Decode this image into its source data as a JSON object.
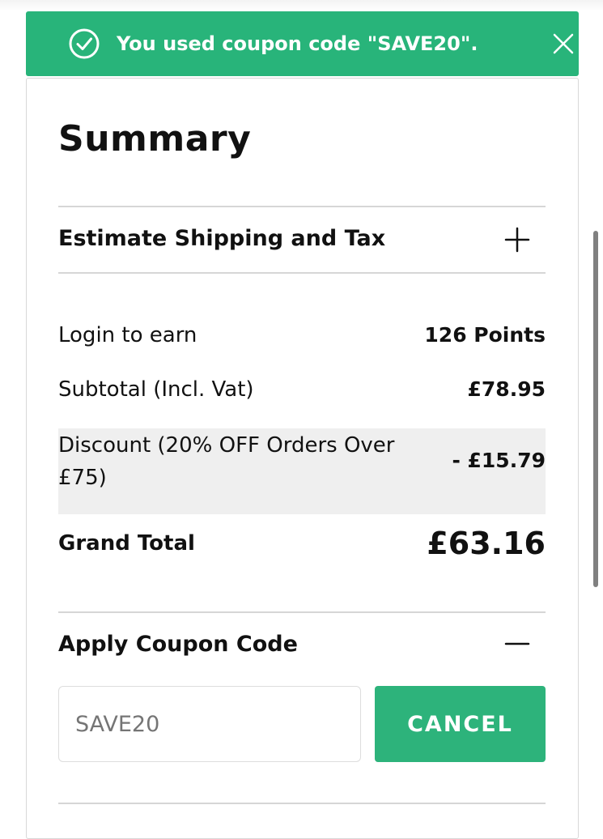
{
  "banner": {
    "message": "You used coupon code \"SAVE20\".",
    "color": "#28b47a"
  },
  "summary": {
    "title": "Summary"
  },
  "shipping": {
    "title": "Estimate Shipping and Tax"
  },
  "totals": {
    "login_label": "Login to earn",
    "login_value": "126 Points",
    "subtotal_label": "Subtotal (Incl. Vat)",
    "subtotal_value": "£78.95",
    "discount_label": "Discount (20% OFF Orders Over £75)",
    "discount_value": "- £15.79",
    "grand_label": "Grand Total",
    "grand_value": "£63.16"
  },
  "coupon": {
    "title": "Apply Coupon Code",
    "input_placeholder": "SAVE20",
    "cancel_label": "CANCEL",
    "button_color": "#2db37b"
  }
}
